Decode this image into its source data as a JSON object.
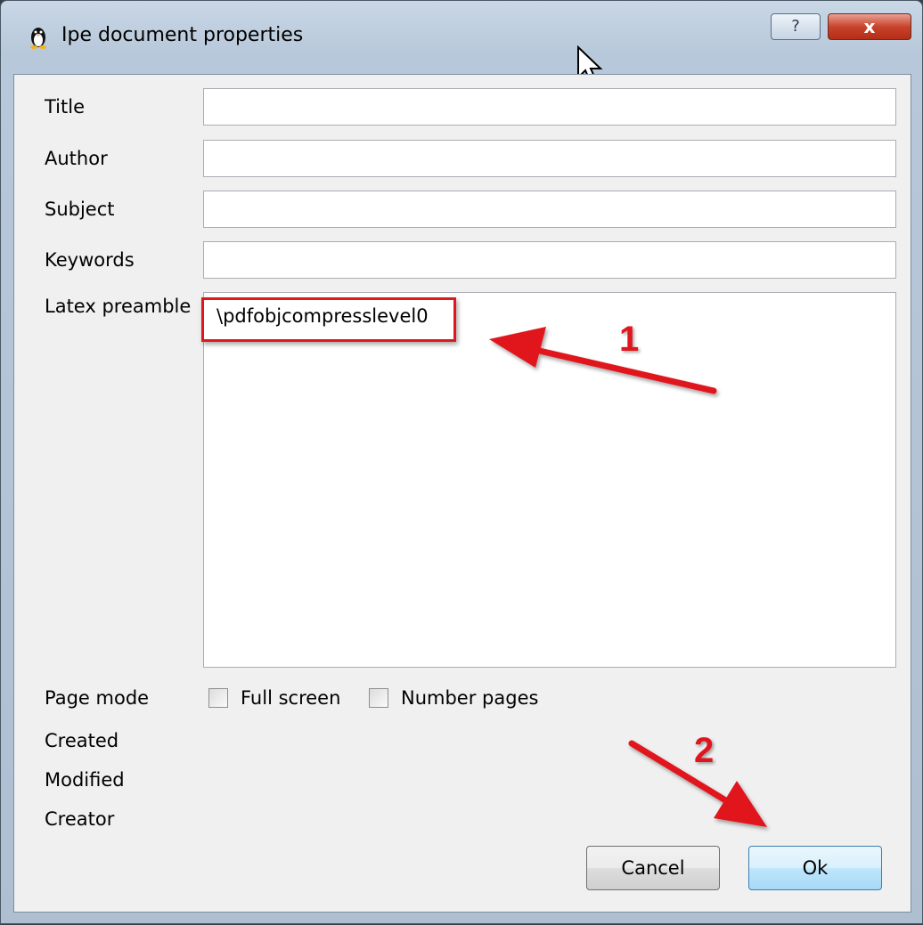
{
  "window": {
    "title": "Ipe document properties",
    "help_label": "?",
    "close_label": "x"
  },
  "fields": [
    {
      "label": "Title",
      "value": ""
    },
    {
      "label": "Author",
      "value": ""
    },
    {
      "label": "Subject",
      "value": ""
    },
    {
      "label": "Keywords",
      "value": ""
    }
  ],
  "preamble": {
    "label": "Latex preamble",
    "value": "\\pdfobjcompresslevel0"
  },
  "page_mode": {
    "label": "Page mode",
    "full_screen_label": "Full screen",
    "full_screen_checked": false,
    "number_pages_label": "Number pages",
    "number_pages_checked": false
  },
  "info": {
    "created_label": "Created",
    "modified_label": "Modified",
    "creator_label": "Creator"
  },
  "buttons": {
    "cancel_label": "Cancel",
    "ok_label": "Ok"
  },
  "annotations": {
    "step1": "1",
    "step2": "2",
    "color": "#e0161e"
  }
}
